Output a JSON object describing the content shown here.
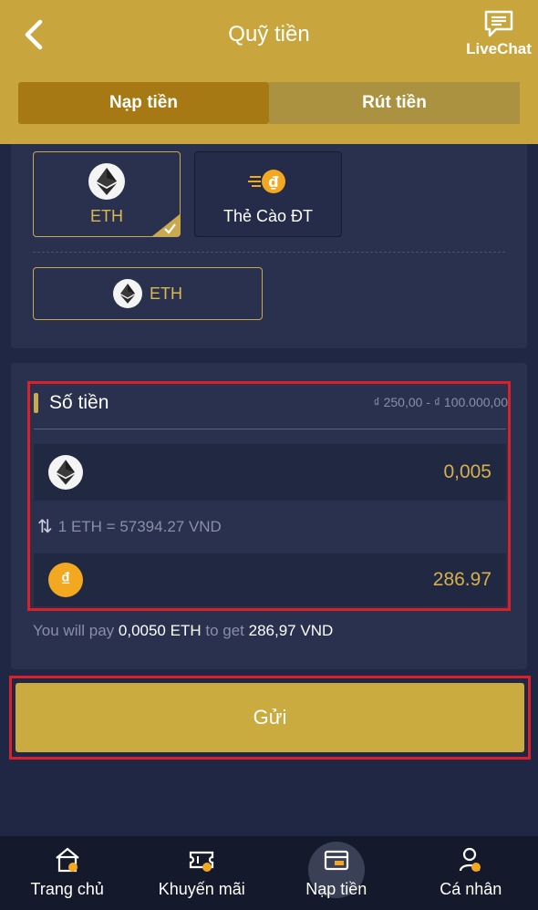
{
  "header": {
    "title": "Quỹ tiền",
    "livechat_label": "LiveChat"
  },
  "tabs": [
    {
      "label": "Nạp tiền",
      "active": true
    },
    {
      "label": "Rút tiền",
      "active": false
    }
  ],
  "methods": [
    {
      "label": "ETH",
      "selected": true,
      "icon": "ethereum-icon"
    },
    {
      "label": "Thẻ Cào ĐT",
      "selected": false,
      "icon": "phone-card-icon"
    }
  ],
  "coin_select": {
    "label": "ETH",
    "icon": "ethereum-icon"
  },
  "amount": {
    "title": "Số tiền",
    "range": "₫ 250,00 - ₫ 100.000,00",
    "eth_value": "0,005",
    "rate": "1 ETH = 57394.27 VND",
    "vnd_symbol": "₫",
    "vnd_value": "286.97"
  },
  "pay_note": {
    "prefix": "You will pay",
    "pay_amount": "0,0050 ETH",
    "middle": "to get",
    "get_amount": "286,97 VND"
  },
  "submit_label": "Gửi",
  "nav": [
    {
      "label": "Trang chủ",
      "icon": "home-icon",
      "active": false
    },
    {
      "label": "Khuyến mãi",
      "icon": "ticket-icon",
      "active": false
    },
    {
      "label": "Nạp tiền",
      "icon": "wallet-icon",
      "active": true
    },
    {
      "label": "Cá nhân",
      "icon": "user-icon",
      "active": false
    }
  ],
  "colors": {
    "header": "#c8a53d",
    "accent": "#c9a94f",
    "background": "#1f2744",
    "highlight_border": "#d9212b"
  }
}
